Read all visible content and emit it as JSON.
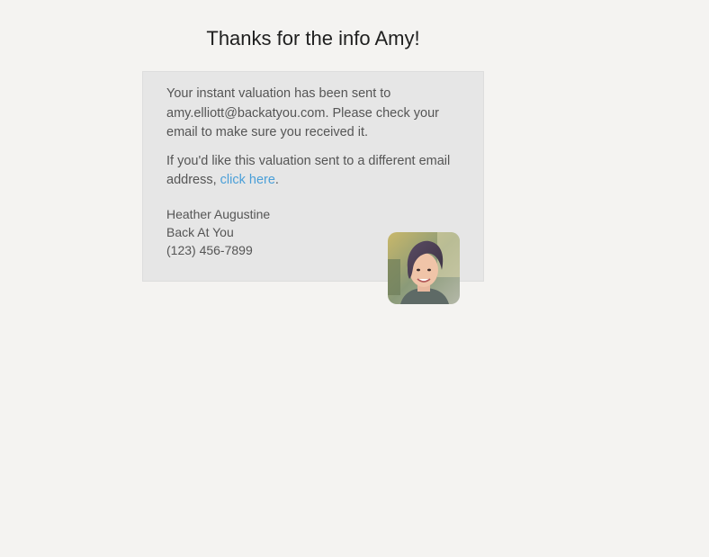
{
  "heading": "Thanks for the info Amy!",
  "message": {
    "line1_prefix": "Your instant valuation has been sent to",
    "email": "amy.elliott@backatyou.com",
    "line1_suffix": ". Please check your email to make sure you received it.",
    "line2_prefix": "If you'd like this valuation sent to a different email address, ",
    "link_text": "click here",
    "line2_suffix": "."
  },
  "agent": {
    "name": "Heather Augustine",
    "company": "Back At You",
    "phone": "(123) 456-7899"
  },
  "colors": {
    "background": "#f4f3f1",
    "card": "#e6e6e6",
    "link": "#4a9fd8"
  }
}
